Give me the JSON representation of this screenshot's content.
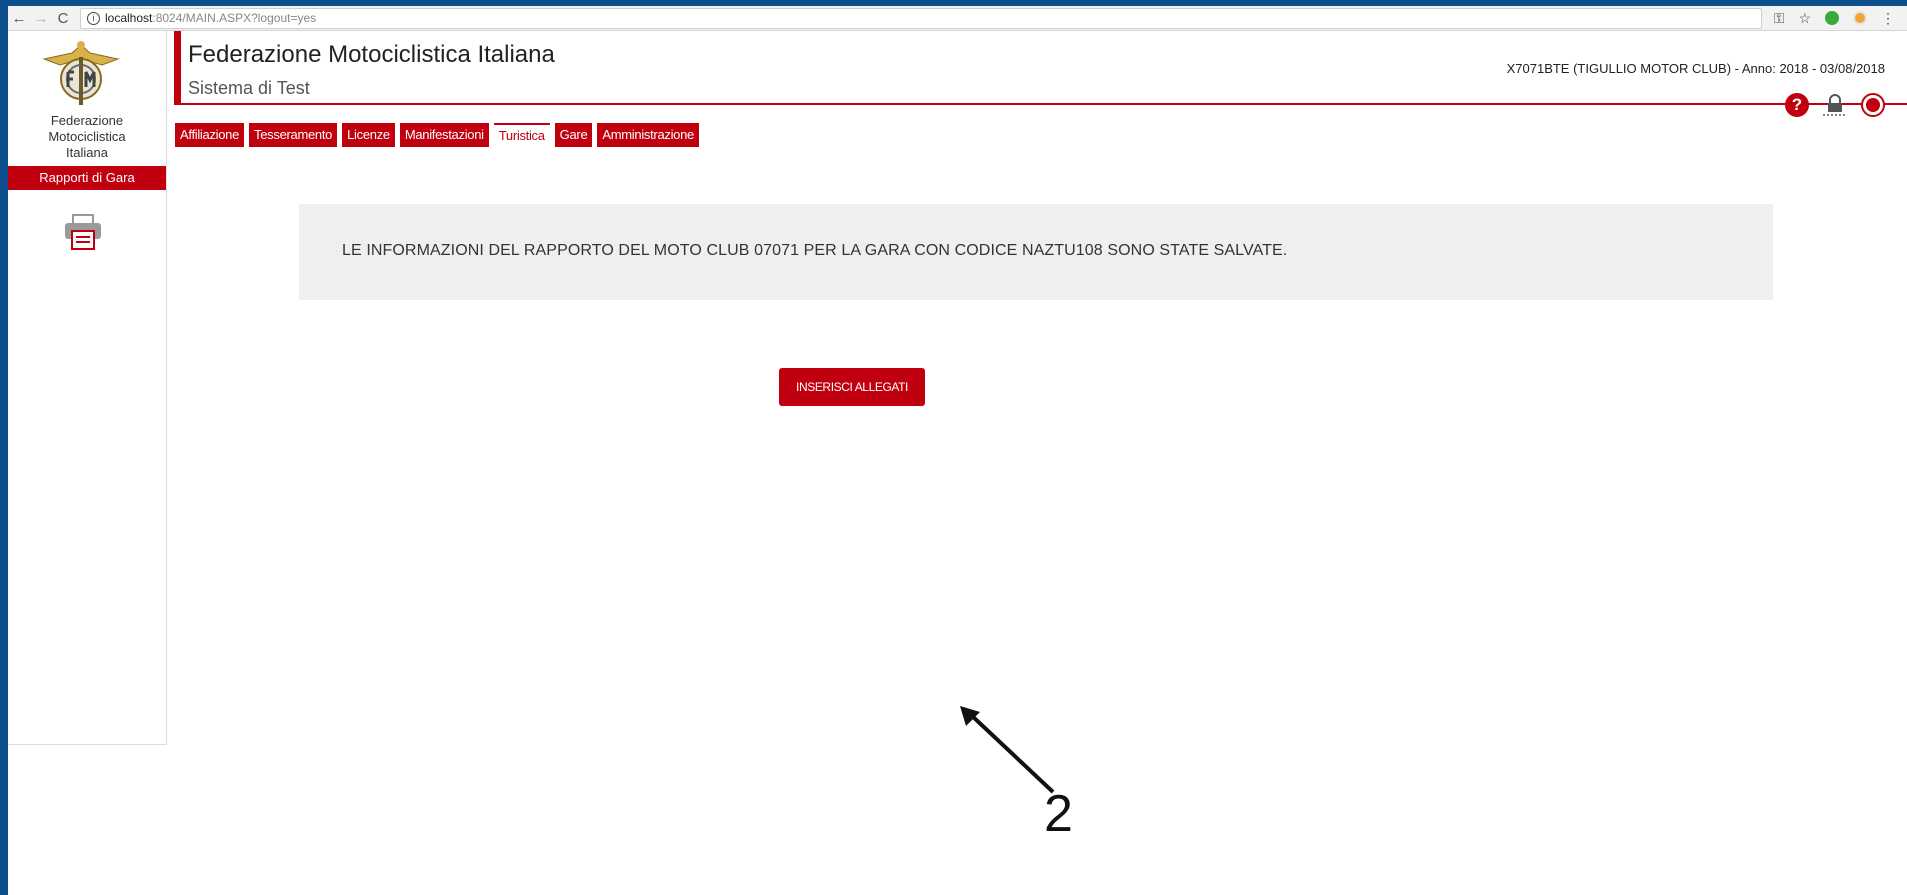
{
  "browser": {
    "url_host": "localhost",
    "url_rest": ":8024/MAIN.ASPX?logout=yes",
    "icons": [
      "back-icon",
      "forward-icon",
      "reload-icon",
      "info-icon",
      "key-icon",
      "star-icon",
      "extension-icon",
      "extension-icon",
      "menu-icon"
    ]
  },
  "sidebar": {
    "org_name": "Federazione\nMotociclistica\nItaliana",
    "item_label": "Rapporti di Gara",
    "icon": "printer-icon"
  },
  "header": {
    "title": "Federazione Motociclistica Italiana",
    "subtitle": "Sistema di Test",
    "user_info": "X7071BTE (TIGULLIO MOTOR CLUB) - Anno: 2018 - 03/08/2018",
    "help_symbol": "?",
    "icons": [
      "help-icon",
      "lock-icon",
      "exit-icon"
    ]
  },
  "tabs": [
    {
      "label": "Affiliazione"
    },
    {
      "label": "Tesseramento"
    },
    {
      "label": "Licenze"
    },
    {
      "label": "Manifestazioni"
    },
    {
      "label": "Turistica",
      "active": true
    },
    {
      "label": "Gare"
    },
    {
      "label": "Amministrazione"
    }
  ],
  "main": {
    "message": "LE INFORMAZIONI DEL RAPPORTO DEL MOTO CLUB 07071 PER LA GARA CON CODICE NAZTU108 SONO STATE SALVATE.",
    "button_label": "INSERISCI ALLEGATI"
  },
  "annotation": {
    "number": "2"
  },
  "colors": {
    "brand_red": "#c0000f",
    "frame_blue": "#0d4f8c",
    "message_bg": "#efefef"
  }
}
